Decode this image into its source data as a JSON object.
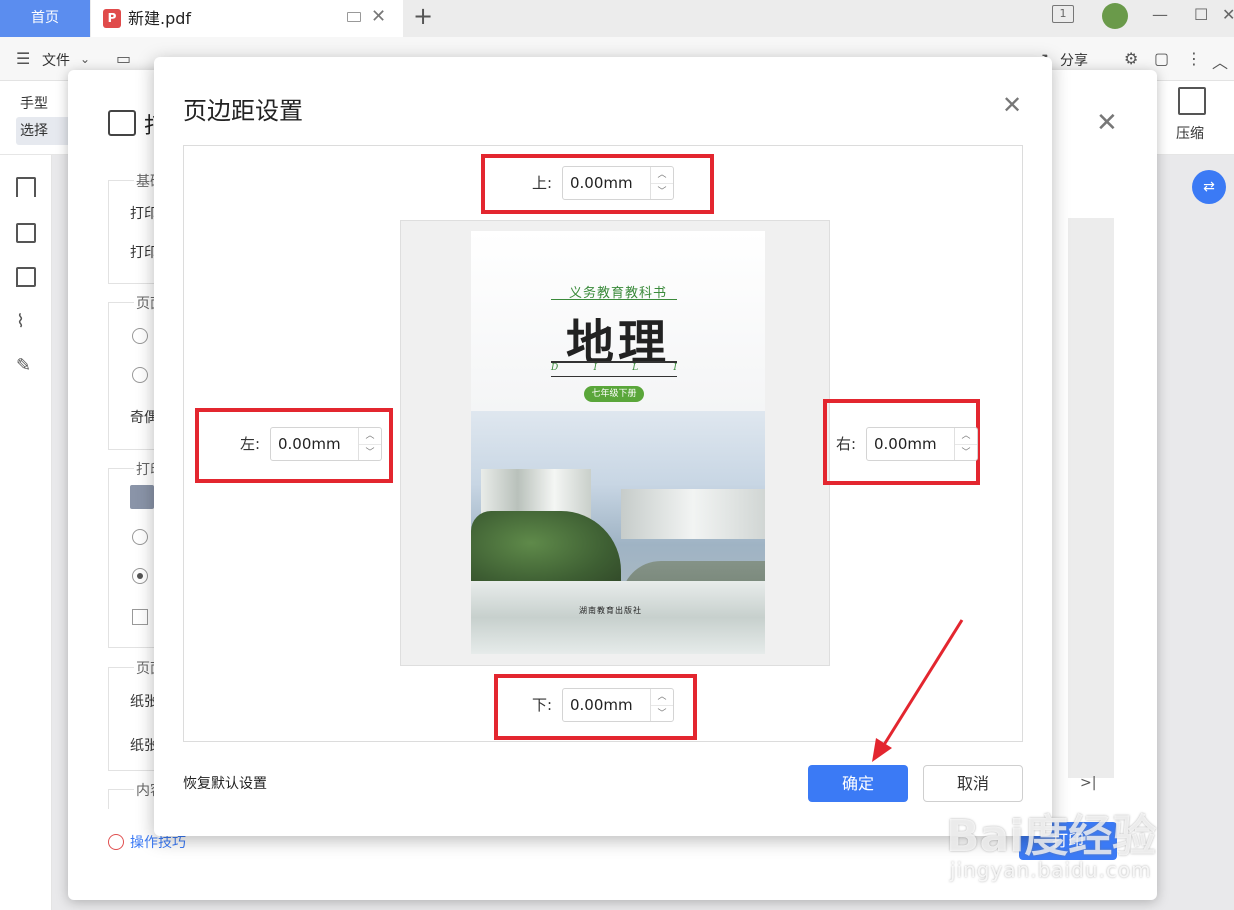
{
  "tabs": {
    "home": "首页",
    "doc": "新建.pdf"
  },
  "menu": {
    "file": "文件",
    "share": "分享"
  },
  "ribbon": {
    "hand": "手型",
    "select": "选择",
    "compress": "压缩"
  },
  "print_dialog": {
    "title": "打印",
    "basic_legend": "基础",
    "basic_text1": "打印",
    "basic_text2": "打印",
    "page_legend": "页面",
    "odd_even": "奇偶",
    "print_legend": "打印",
    "paper_legend": "页面",
    "paper_text1": "纸张",
    "paper_text2": "纸张",
    "content_legend": "内容",
    "tips": "操作技巧",
    "print_button": "打印",
    "pager_glyph": ">|"
  },
  "margin_dialog": {
    "title": "页边距设置",
    "fields": {
      "top": {
        "label": "上:",
        "value": "0.00mm"
      },
      "left": {
        "label": "左:",
        "value": "0.00mm"
      },
      "right": {
        "label": "右:",
        "value": "0.00mm"
      },
      "bottom": {
        "label": "下:",
        "value": "0.00mm"
      }
    },
    "reset": "恢复默认设置",
    "ok": "确定",
    "cancel": "取消"
  },
  "cover": {
    "subtitle": "义务教育教科书",
    "title": "地理",
    "pinyin": [
      "D",
      "I",
      "L",
      "I"
    ],
    "grade": "七年级下册",
    "publisher": "湖南教育出版社"
  },
  "watermark": {
    "main": "Bai度经验",
    "sub": "jingyan.baidu.com"
  },
  "colors": {
    "accent": "#3b7af5",
    "highlight": "#e3262f",
    "home_tab": "#5b8def"
  }
}
